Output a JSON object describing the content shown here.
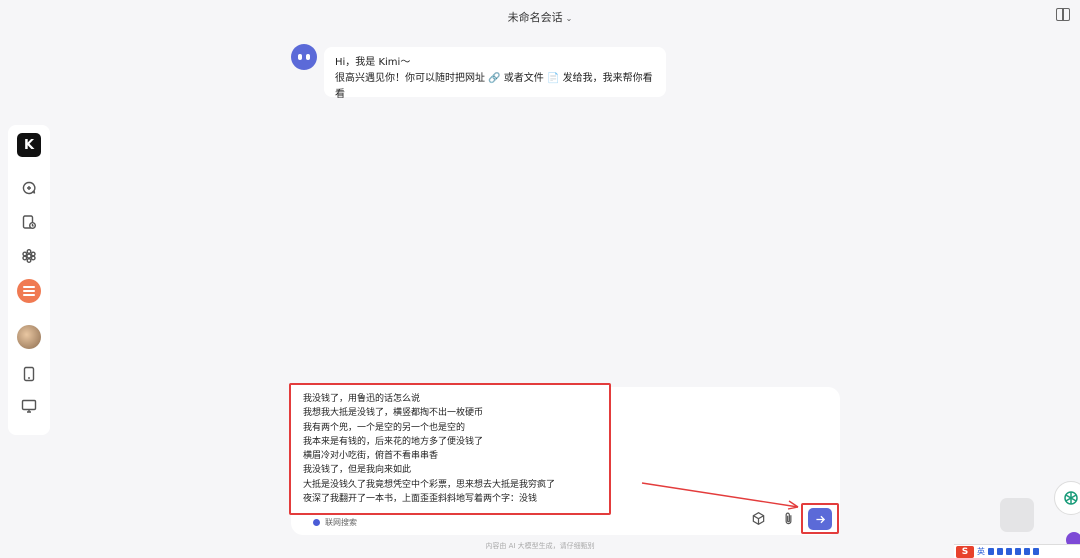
{
  "header": {
    "title": "未命名会话",
    "title_chevron": "chevron-down-icon",
    "panel_icon": "panel-toggle-icon"
  },
  "sidebar": {
    "logo_text": "K",
    "items": [
      {
        "icon": "new-chat-icon"
      },
      {
        "icon": "history-icon"
      },
      {
        "icon": "explore-icon"
      },
      {
        "icon": "kimi-plus-icon"
      },
      {
        "icon": "avatar"
      },
      {
        "icon": "mobile-icon"
      },
      {
        "icon": "desktop-icon"
      }
    ]
  },
  "messages": [
    {
      "role": "assistant",
      "lines": [
        "Hi，我是 Kimi～",
        "很高兴遇见你！你可以随时把网址 🔗 或者文件 📄 发给我，我来帮你看看"
      ]
    }
  ],
  "composer": {
    "lines": [
      "我没钱了，用鲁迅的话怎么说",
      "我想我大抵是没钱了，横竖都掏不出一枚硬币",
      "我有两个兜，一个是空的另一个也是空的",
      "我本来是有钱的，后来花的地方多了便没钱了",
      "横眉冷对小吃街，俯首不看串串香",
      "我没钱了，但是我向来如此",
      "大抵是没钱久了我竟想凭空中个彩票，思来想去大抵是我穷疯了",
      "夜深了我翻开了一本书，上面歪歪斜斜地写着两个字：没钱"
    ],
    "web_search_label": "联网搜索",
    "tools": [
      "cube-icon",
      "paperclip-icon"
    ],
    "send_icon": "send-icon"
  },
  "footer": {
    "disclaimer": "内容由 AI 大模型生成，请仔细甄别"
  },
  "ime": {
    "logo": "S",
    "label": "英"
  },
  "colors": {
    "accent": "#5b6ad8",
    "highlight": "#e33c3c",
    "background": "#f6f6f8"
  }
}
